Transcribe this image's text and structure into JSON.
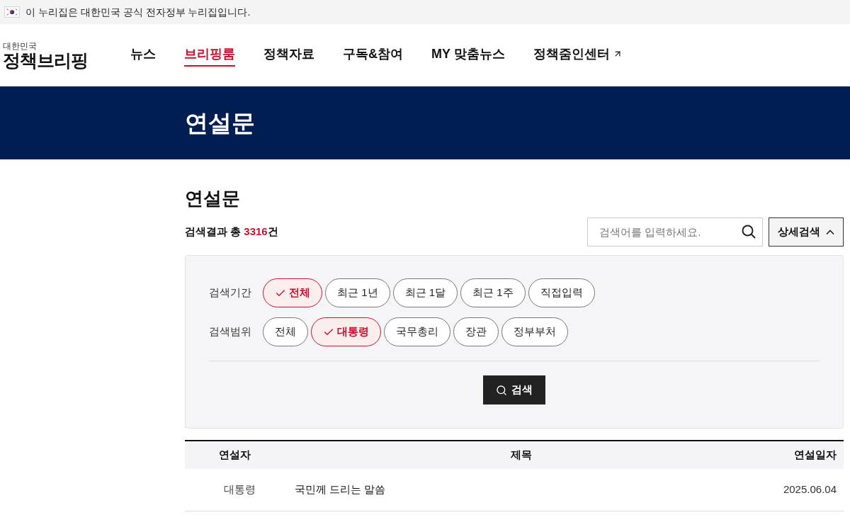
{
  "gov_banner": {
    "text": "이 누리집은 대한민국 공식 전자정부 누리집입니다."
  },
  "logo": {
    "small": "대한민국",
    "main": "정책브리핑"
  },
  "nav": [
    {
      "label": "뉴스",
      "selected": false,
      "external": false
    },
    {
      "label": "브리핑룸",
      "selected": true,
      "external": false
    },
    {
      "label": "정책자료",
      "selected": false,
      "external": false
    },
    {
      "label": "구독&참여",
      "selected": false,
      "external": false
    },
    {
      "label": "MY 맞춤뉴스",
      "selected": false,
      "external": false
    },
    {
      "label": "정책줌인센터",
      "selected": false,
      "external": true
    }
  ],
  "hero": {
    "title": "연설문"
  },
  "page_title": "연설문",
  "result": {
    "prefix": "검색결과 총 ",
    "count": "3316",
    "suffix": "건"
  },
  "search": {
    "placeholder": "검색어를 입력하세요."
  },
  "detail_button": {
    "label": "상세검색",
    "expanded": true
  },
  "filters": [
    {
      "label": "검색기간",
      "options": [
        {
          "label": "전체",
          "selected": true
        },
        {
          "label": "최근 1년",
          "selected": false
        },
        {
          "label": "최근 1달",
          "selected": false
        },
        {
          "label": "최근 1주",
          "selected": false
        },
        {
          "label": "직접입력",
          "selected": false
        }
      ]
    },
    {
      "label": "검색범위",
      "options": [
        {
          "label": "전체",
          "selected": false
        },
        {
          "label": "대통령",
          "selected": true
        },
        {
          "label": "국무총리",
          "selected": false
        },
        {
          "label": "장관",
          "selected": false
        },
        {
          "label": "정부부처",
          "selected": false
        }
      ]
    }
  ],
  "search_button": "검색",
  "table": {
    "columns": [
      "연설자",
      "제목",
      "연설일자"
    ],
    "rows": [
      [
        "대통령",
        "국민께 드리는 말씀",
        "2025.06.04"
      ]
    ]
  }
}
